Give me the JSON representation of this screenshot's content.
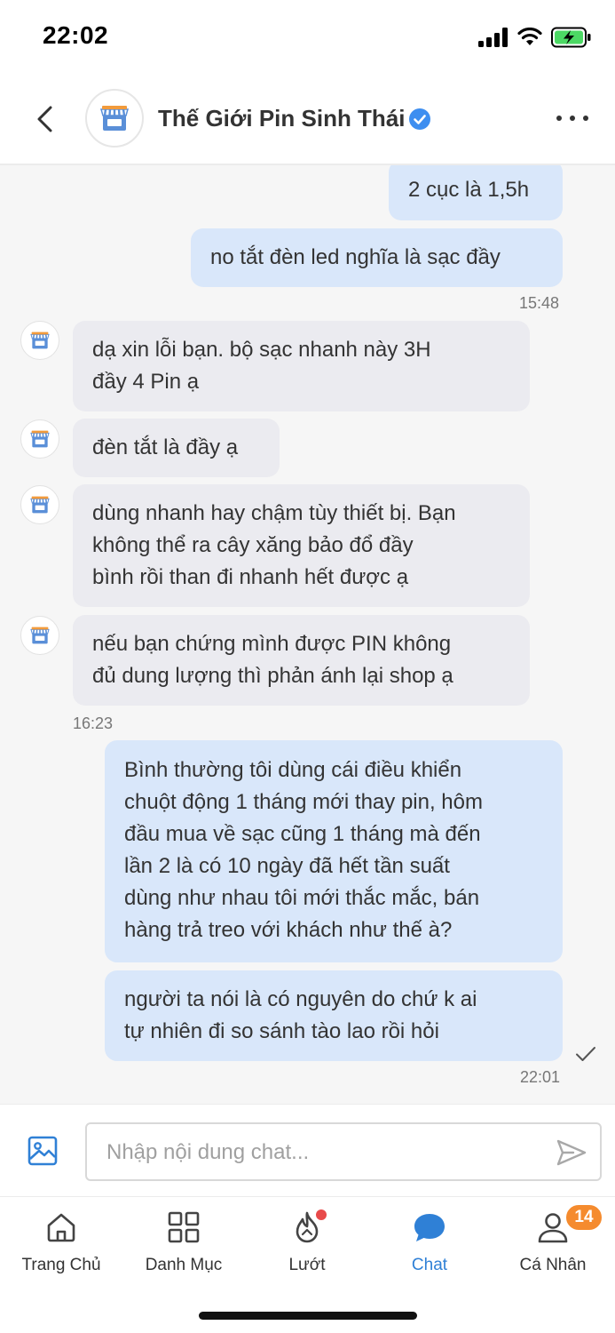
{
  "status_bar": {
    "time": "22:02"
  },
  "header": {
    "shop_name": "Thế Giới Pin Sinh Thái",
    "icons": {
      "back": "chevron-left-icon",
      "verified": "verified-check-icon",
      "more": "more-dots-icon"
    }
  },
  "messages": [
    {
      "direction": "out",
      "text": "2 cục là 1,5h"
    },
    {
      "direction": "out",
      "text": "no tắt đèn led nghĩa là sạc đầy"
    },
    {
      "type": "timestamp",
      "text": "15:48"
    },
    {
      "direction": "in",
      "text": "dạ xin lỗi bạn. bộ sạc nhanh này 3H\nđầy 4 Pin ạ"
    },
    {
      "direction": "in",
      "text": "đèn tắt là đầy ạ"
    },
    {
      "direction": "in",
      "text": "dùng nhanh hay chậm tùy thiết bị. Bạn\nkhông thể ra cây xăng bảo đổ đầy\nbình rồi than đi nhanh hết được ạ"
    },
    {
      "direction": "in",
      "text": "nếu bạn chứng mình được PIN không\nđủ dung lượng thì phản ánh lại shop ạ"
    },
    {
      "type": "timestamp",
      "text": "16:23"
    },
    {
      "direction": "out",
      "text": "Bình thường tôi dùng cái điều khiển\nchuột động 1 tháng mới thay pin, hôm\nđầu mua về sạc cũng 1 tháng mà đến\nlần 2 là có 10 ngày đã hết tần suất\ndùng như nhau tôi mới thắc mắc, bán\nhàng trả treo với khách như thế à?"
    },
    {
      "direction": "out",
      "text": "người ta nói là có nguyên do chứ k ai\ntự nhiên đi so sánh tào lao rồi hỏi"
    },
    {
      "type": "timestamp",
      "text": "22:01"
    }
  ],
  "input_bar": {
    "placeholder": "Nhập nội dung chat...",
    "value": "",
    "icons": {
      "image": "image-icon",
      "send": "send-icon"
    }
  },
  "bottom_nav": {
    "items": [
      {
        "label": "Trang Chủ",
        "icon": "home-icon"
      },
      {
        "label": "Danh Mục",
        "icon": "grid-icon"
      },
      {
        "label": "Lướt",
        "icon": "flame-icon"
      },
      {
        "label": "Chat",
        "icon": "chat-bubble-icon",
        "active": true
      },
      {
        "label": "Cá Nhân",
        "icon": "person-icon",
        "badge": "14"
      }
    ]
  },
  "colors": {
    "accent": "#2f80d6",
    "outgoing_bubble": "#d9e7fa",
    "incoming_bubble": "#ebebf0",
    "badge": "#f58b2e",
    "notification_dot": "#e84a4a"
  }
}
